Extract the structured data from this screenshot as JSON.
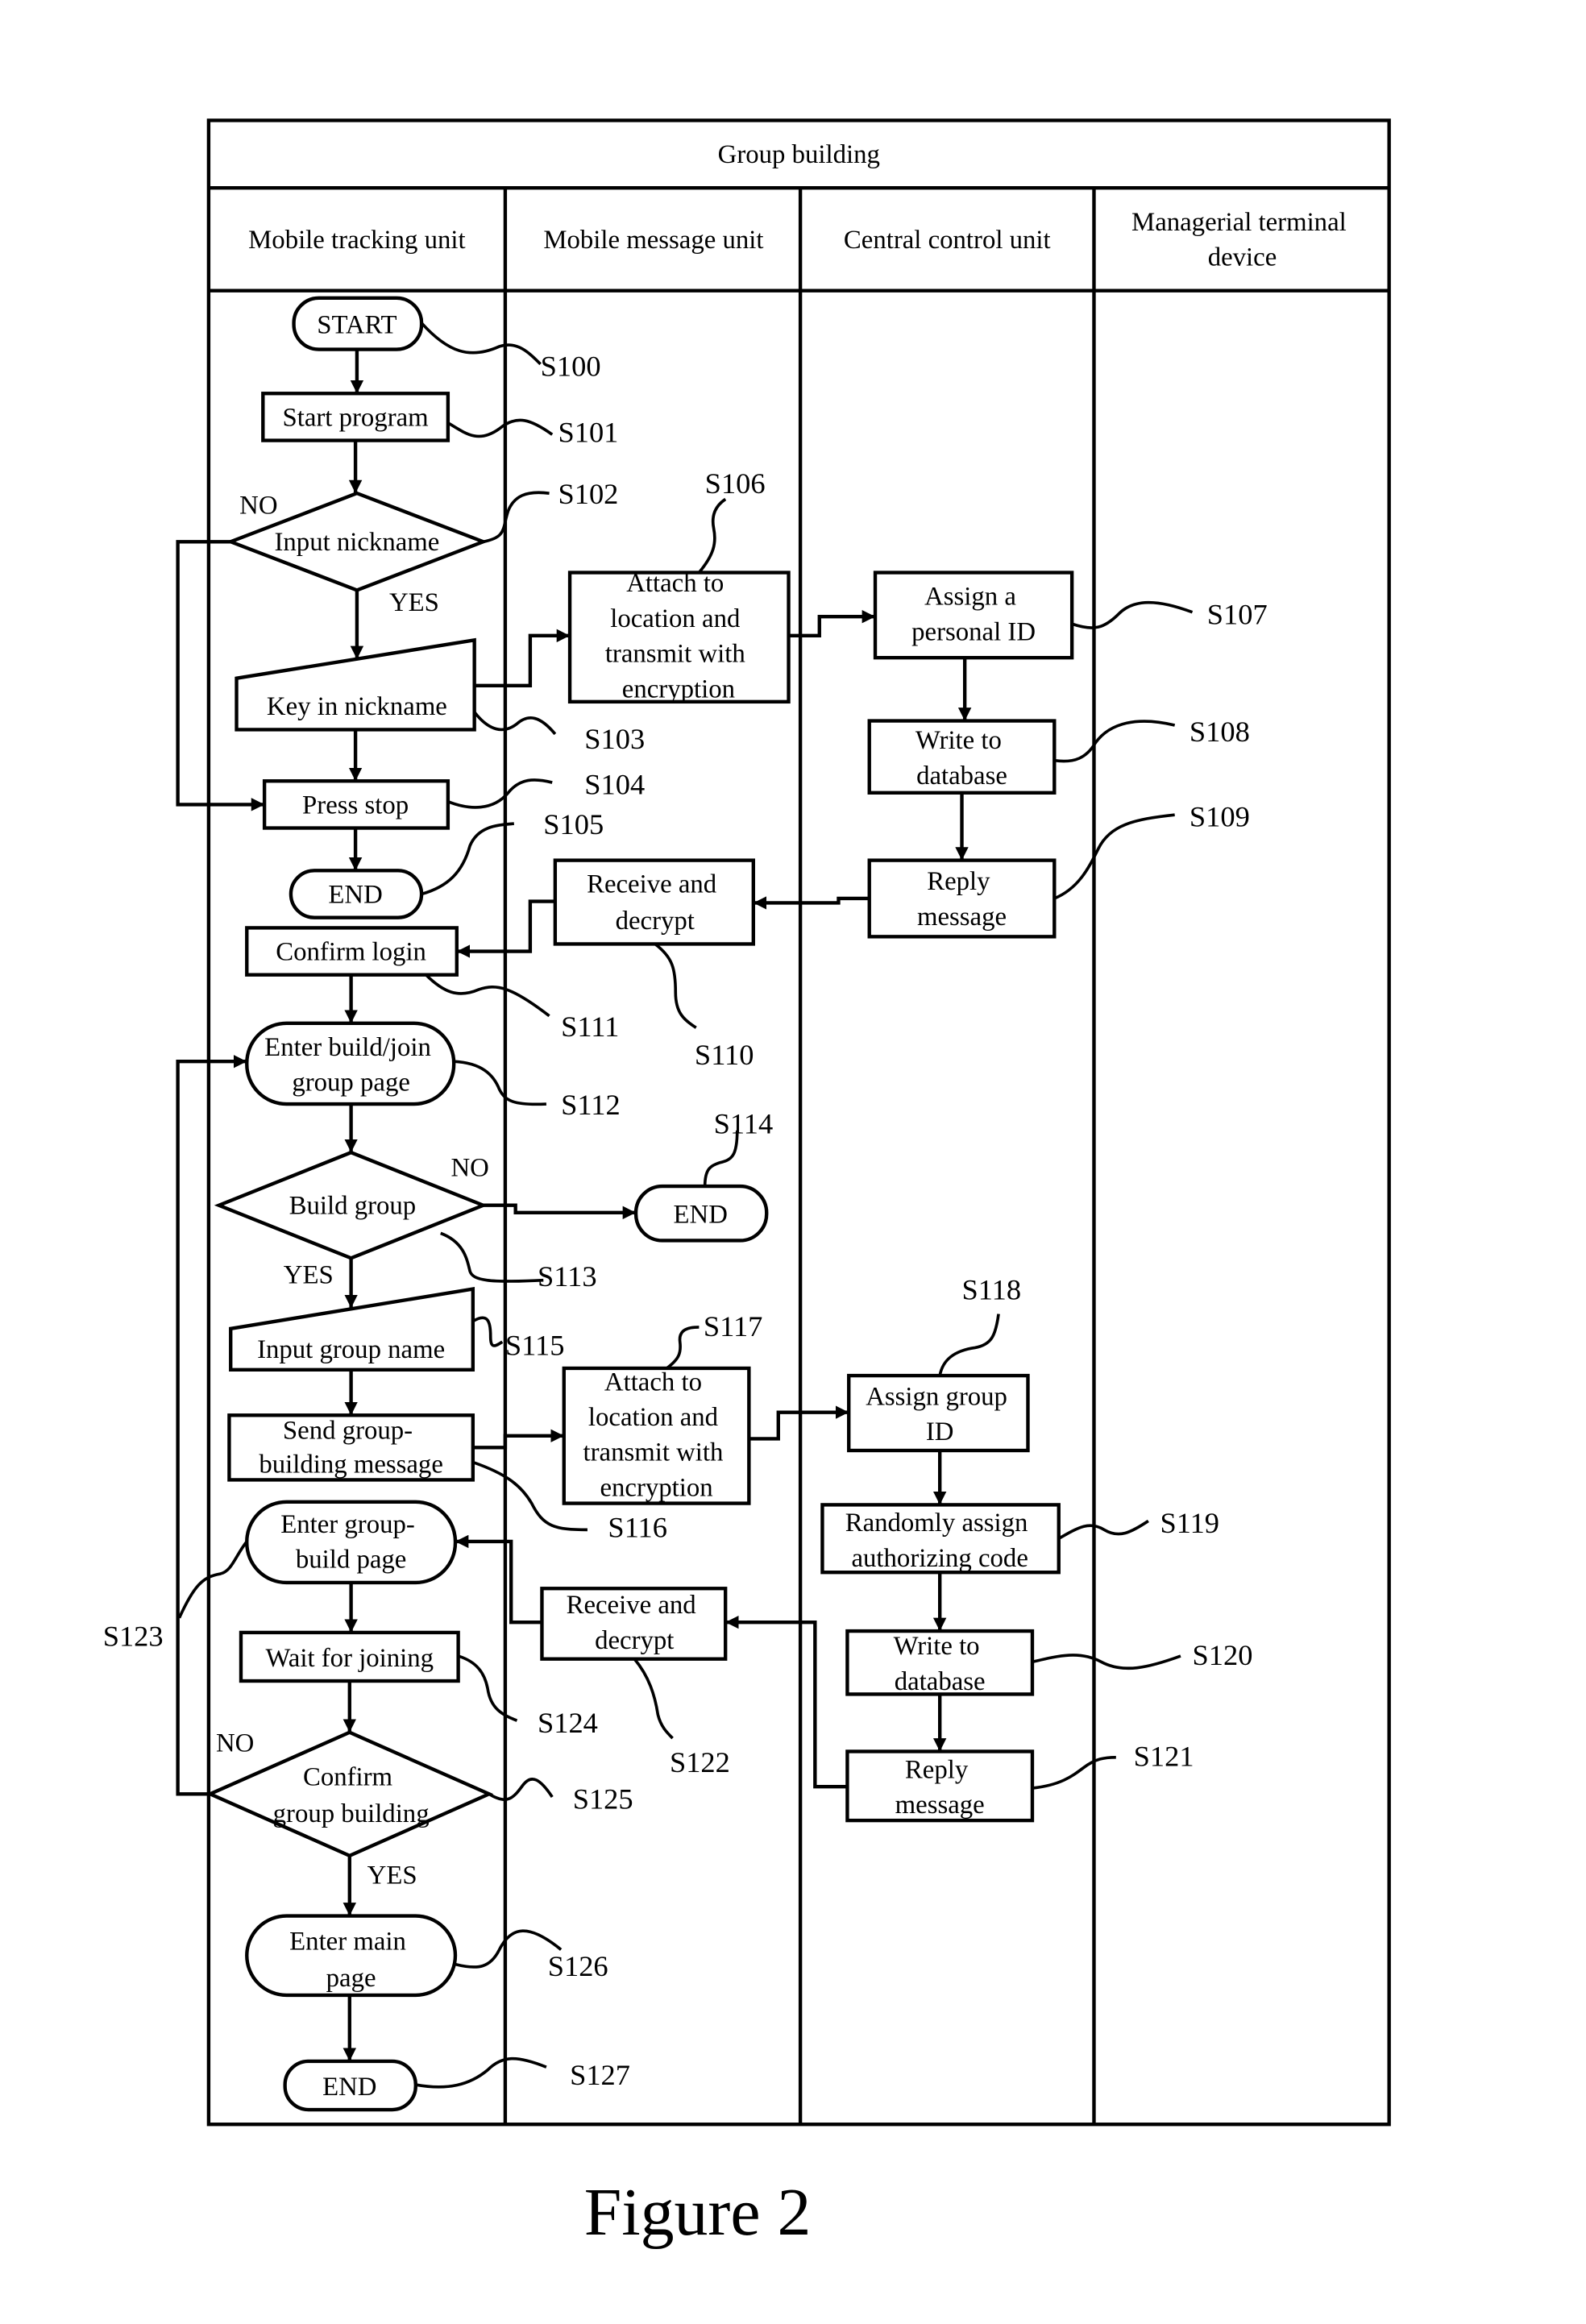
{
  "title": "Group building",
  "caption": "Figure 2",
  "lanes": [
    {
      "label_lines": [
        "Mobile tracking unit"
      ]
    },
    {
      "label_lines": [
        "Mobile message unit"
      ]
    },
    {
      "label_lines": [
        "Central control unit"
      ]
    },
    {
      "label_lines": [
        "Managerial terminal",
        "device"
      ]
    }
  ],
  "nodes": {
    "s100": {
      "step": "S100",
      "shape": "terminator",
      "lines": [
        "START"
      ]
    },
    "s101": {
      "step": "S101",
      "shape": "process",
      "lines": [
        "Start program"
      ]
    },
    "s102": {
      "step": "S102",
      "shape": "decision",
      "lines": [
        "Input nickname"
      ]
    },
    "s103": {
      "step": "S103",
      "shape": "manual-input",
      "lines": [
        "Key in nickname"
      ]
    },
    "s104": {
      "step": "S104",
      "shape": "process",
      "lines": [
        "Press stop"
      ]
    },
    "s105": {
      "step": "S105",
      "shape": "terminator",
      "lines": [
        "END"
      ]
    },
    "s106": {
      "step": "S106",
      "shape": "process",
      "lines": [
        "Attach to",
        "location and",
        "transmit with",
        "encryption"
      ]
    },
    "s107": {
      "step": "S107",
      "shape": "process",
      "lines": [
        "Assign a",
        "personal ID"
      ]
    },
    "s108": {
      "step": "S108",
      "shape": "process",
      "lines": [
        "Write to",
        "database"
      ]
    },
    "s109": {
      "step": "S109",
      "shape": "process",
      "lines": [
        "Reply",
        "message"
      ]
    },
    "s110": {
      "step": "S110",
      "shape": "process",
      "lines": [
        "Receive and",
        "decrypt"
      ]
    },
    "s111": {
      "step": "S111",
      "shape": "process",
      "lines": [
        "Confirm login"
      ]
    },
    "s112": {
      "step": "S112",
      "shape": "terminator",
      "lines": [
        "Enter build/join",
        "group page"
      ]
    },
    "s113": {
      "step": "S113",
      "shape": "decision",
      "lines": [
        "Build group"
      ]
    },
    "s114": {
      "step": "S114",
      "shape": "terminator",
      "lines": [
        "END"
      ]
    },
    "s115": {
      "step": "S115",
      "shape": "manual-input",
      "lines": [
        "Input group name"
      ]
    },
    "s116": {
      "step": "S116",
      "shape": "process",
      "lines": [
        "Send group-",
        "building message"
      ]
    },
    "s117": {
      "step": "S117",
      "shape": "process",
      "lines": [
        "Attach to",
        "location and",
        "transmit with",
        "encryption"
      ]
    },
    "s118": {
      "step": "S118",
      "shape": "process",
      "lines": [
        "Assign group",
        "ID"
      ]
    },
    "s119": {
      "step": "S119",
      "shape": "process",
      "lines": [
        "Randomly assign",
        "authorizing code"
      ]
    },
    "s120": {
      "step": "S120",
      "shape": "process",
      "lines": [
        "Write to",
        "database"
      ]
    },
    "s121": {
      "step": "S121",
      "shape": "process",
      "lines": [
        "Reply",
        "message"
      ]
    },
    "s122": {
      "step": "S122",
      "shape": "process",
      "lines": [
        "Receive and",
        "decrypt"
      ]
    },
    "s123": {
      "step": "S123",
      "shape": "terminator",
      "lines": [
        "Enter group-",
        "build page"
      ]
    },
    "s124": {
      "step": "S124",
      "shape": "process",
      "lines": [
        "Wait for joining"
      ]
    },
    "s125": {
      "step": "S125",
      "shape": "decision",
      "lines": [
        "Confirm",
        "group building"
      ]
    },
    "s126": {
      "step": "S126",
      "shape": "terminator",
      "lines": [
        "Enter main",
        "page"
      ]
    },
    "s127": {
      "step": "S127",
      "shape": "terminator",
      "lines": [
        "END"
      ]
    }
  },
  "branches": {
    "s102_no": "NO",
    "s102_yes": "YES",
    "s113_no": "NO",
    "s113_yes": "YES",
    "s125_no": "NO",
    "s125_yes": "YES"
  },
  "edges": [
    {
      "from": "s100",
      "to": "s101"
    },
    {
      "from": "s101",
      "to": "s102"
    },
    {
      "from": "s102",
      "to": "s103",
      "label": "YES"
    },
    {
      "from": "s102",
      "to": "s104",
      "label": "NO"
    },
    {
      "from": "s103",
      "to": "s104"
    },
    {
      "from": "s103",
      "to": "s106"
    },
    {
      "from": "s104",
      "to": "s105"
    },
    {
      "from": "s106",
      "to": "s107"
    },
    {
      "from": "s107",
      "to": "s108"
    },
    {
      "from": "s108",
      "to": "s109"
    },
    {
      "from": "s109",
      "to": "s110"
    },
    {
      "from": "s110",
      "to": "s111"
    },
    {
      "from": "s111",
      "to": "s112"
    },
    {
      "from": "s112",
      "to": "s113"
    },
    {
      "from": "s113",
      "to": "s114",
      "label": "NO"
    },
    {
      "from": "s113",
      "to": "s115",
      "label": "YES"
    },
    {
      "from": "s115",
      "to": "s116"
    },
    {
      "from": "s116",
      "to": "s117"
    },
    {
      "from": "s117",
      "to": "s118"
    },
    {
      "from": "s118",
      "to": "s119"
    },
    {
      "from": "s119",
      "to": "s120"
    },
    {
      "from": "s120",
      "to": "s121"
    },
    {
      "from": "s121",
      "to": "s122"
    },
    {
      "from": "s122",
      "to": "s123"
    },
    {
      "from": "s123",
      "to": "s124"
    },
    {
      "from": "s124",
      "to": "s125"
    },
    {
      "from": "s125",
      "to": "s112",
      "label": "NO"
    },
    {
      "from": "s125",
      "to": "s126",
      "label": "YES"
    },
    {
      "from": "s126",
      "to": "s127"
    }
  ]
}
